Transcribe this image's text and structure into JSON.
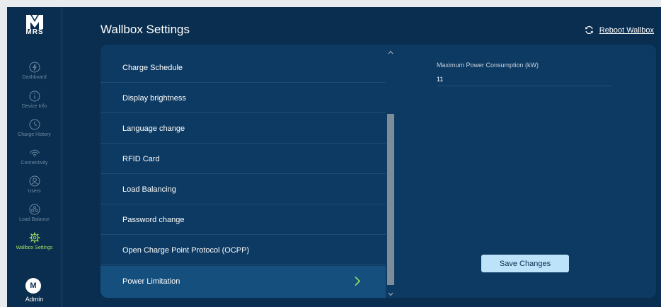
{
  "app": {
    "brand": "MRS",
    "page_title": "Wallbox Settings",
    "reboot_label": "Reboot Wallbox"
  },
  "sidebar": {
    "items": [
      {
        "label": "Dashboard",
        "icon": "dashboard-icon"
      },
      {
        "label": "Device Info",
        "icon": "info-icon"
      },
      {
        "label": "Charge History",
        "icon": "clock-icon"
      },
      {
        "label": "Connectivity",
        "icon": "wifi-icon"
      },
      {
        "label": "Users",
        "icon": "user-icon"
      },
      {
        "label": "Load Balance",
        "icon": "load-balance-icon"
      },
      {
        "label": "Wallbox Settings",
        "icon": "gear-icon",
        "active": true
      }
    ],
    "user": {
      "initial": "M",
      "name": "Admin"
    }
  },
  "settings_list": [
    {
      "label": "Charge Schedule"
    },
    {
      "label": "Display brightness"
    },
    {
      "label": "Language change"
    },
    {
      "label": "RFID Card"
    },
    {
      "label": "Load Balancing"
    },
    {
      "label": "Password change"
    },
    {
      "label": "Open Charge Point Protocol (OCPP)"
    },
    {
      "label": "Power Limitation",
      "selected": true
    }
  ],
  "detail": {
    "field_label": "Maximum Power Consumption (kW)",
    "field_value": "11",
    "save_label": "Save Changes"
  },
  "colors": {
    "background": "#0a2e4f",
    "panel": "#0d3a62",
    "selected_row": "#144f7e",
    "active_accent": "#9be15d",
    "button": "#bde3fa"
  }
}
